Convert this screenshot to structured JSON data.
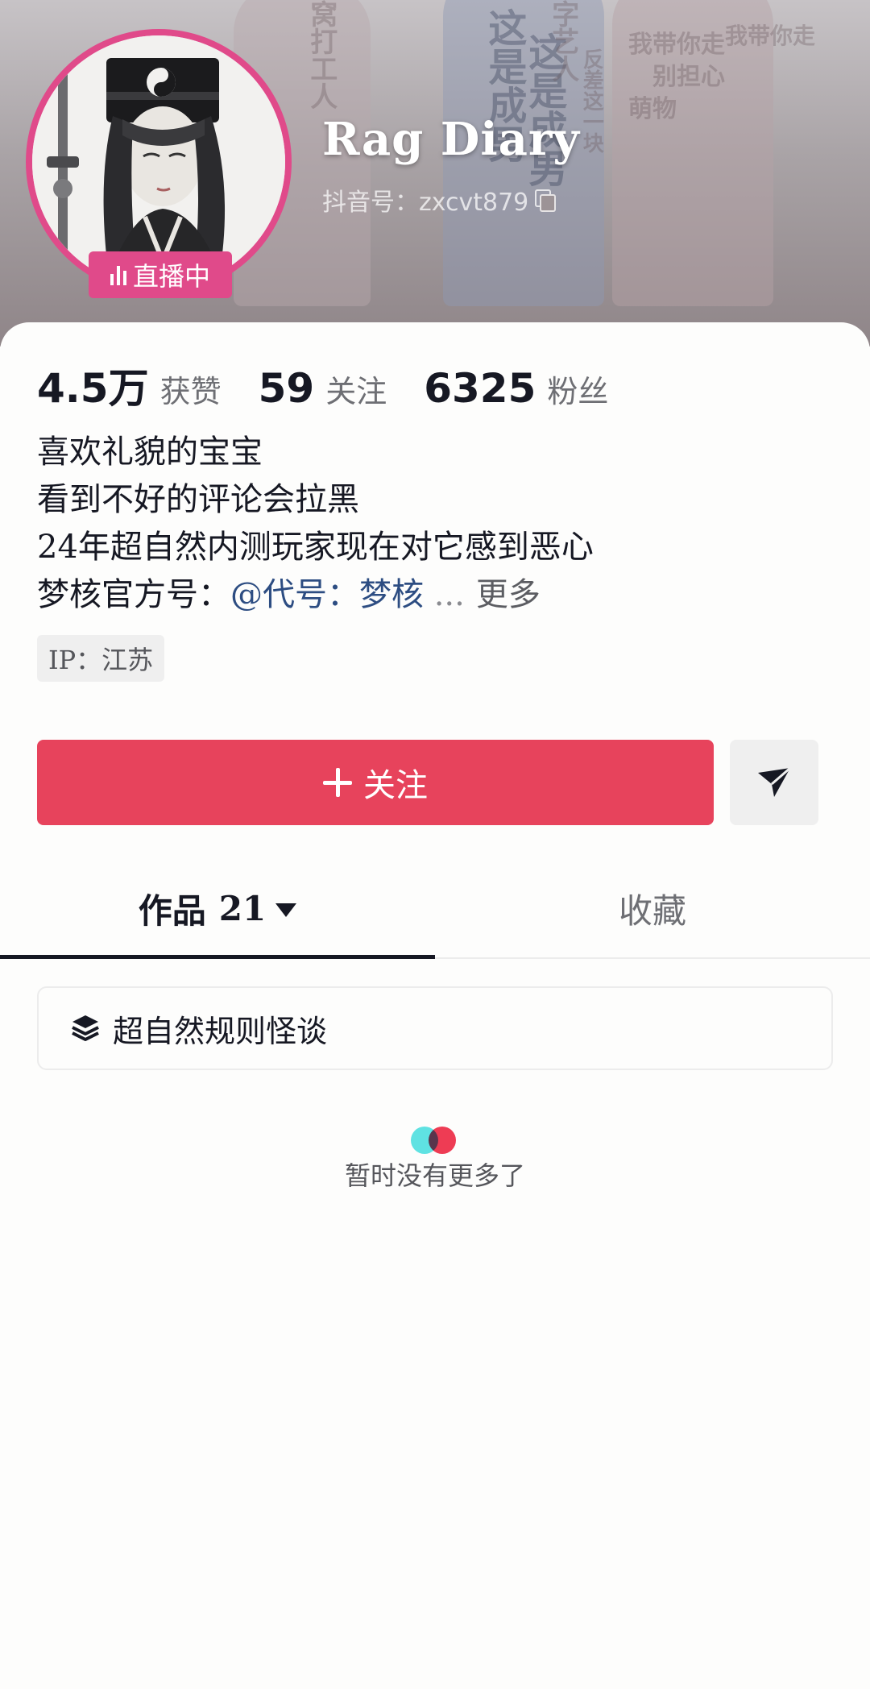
{
  "header": {
    "name": "Rag Diary",
    "douyin_id": "抖音号：zxcvt879",
    "live_badge": "直播中",
    "banner_wordart": [
      "这是成男",
      "我带你走",
      "窝打工人",
      "萌物",
      "别担心",
      "字艺人",
      "反差这一块"
    ]
  },
  "stats": [
    {
      "value": "4.5万",
      "label": "获赞"
    },
    {
      "value": "59",
      "label": "关注"
    },
    {
      "value": "6325",
      "label": "粉丝"
    }
  ],
  "bio": {
    "lines": [
      "喜欢礼貌的宝宝",
      "看到不好的评论会拉黑",
      "24年超自然内测玩家现在对它感到恶心"
    ],
    "last_line_prefix": "梦核官方号：",
    "mention": "@代号：梦核",
    "ellipsis": "...",
    "more": "更多"
  },
  "ip_tag": "IP：江苏",
  "actions": {
    "follow_label": "关注"
  },
  "tabs": {
    "works_label": "作品",
    "works_count": "21",
    "favorites_label": "收藏"
  },
  "collection": {
    "title": "超自然规则怪谈"
  },
  "empty_text": "暂时没有更多了",
  "colors": {
    "accent": "#e7435c",
    "live": "#e04a8a",
    "mention": "#2d4d82"
  }
}
